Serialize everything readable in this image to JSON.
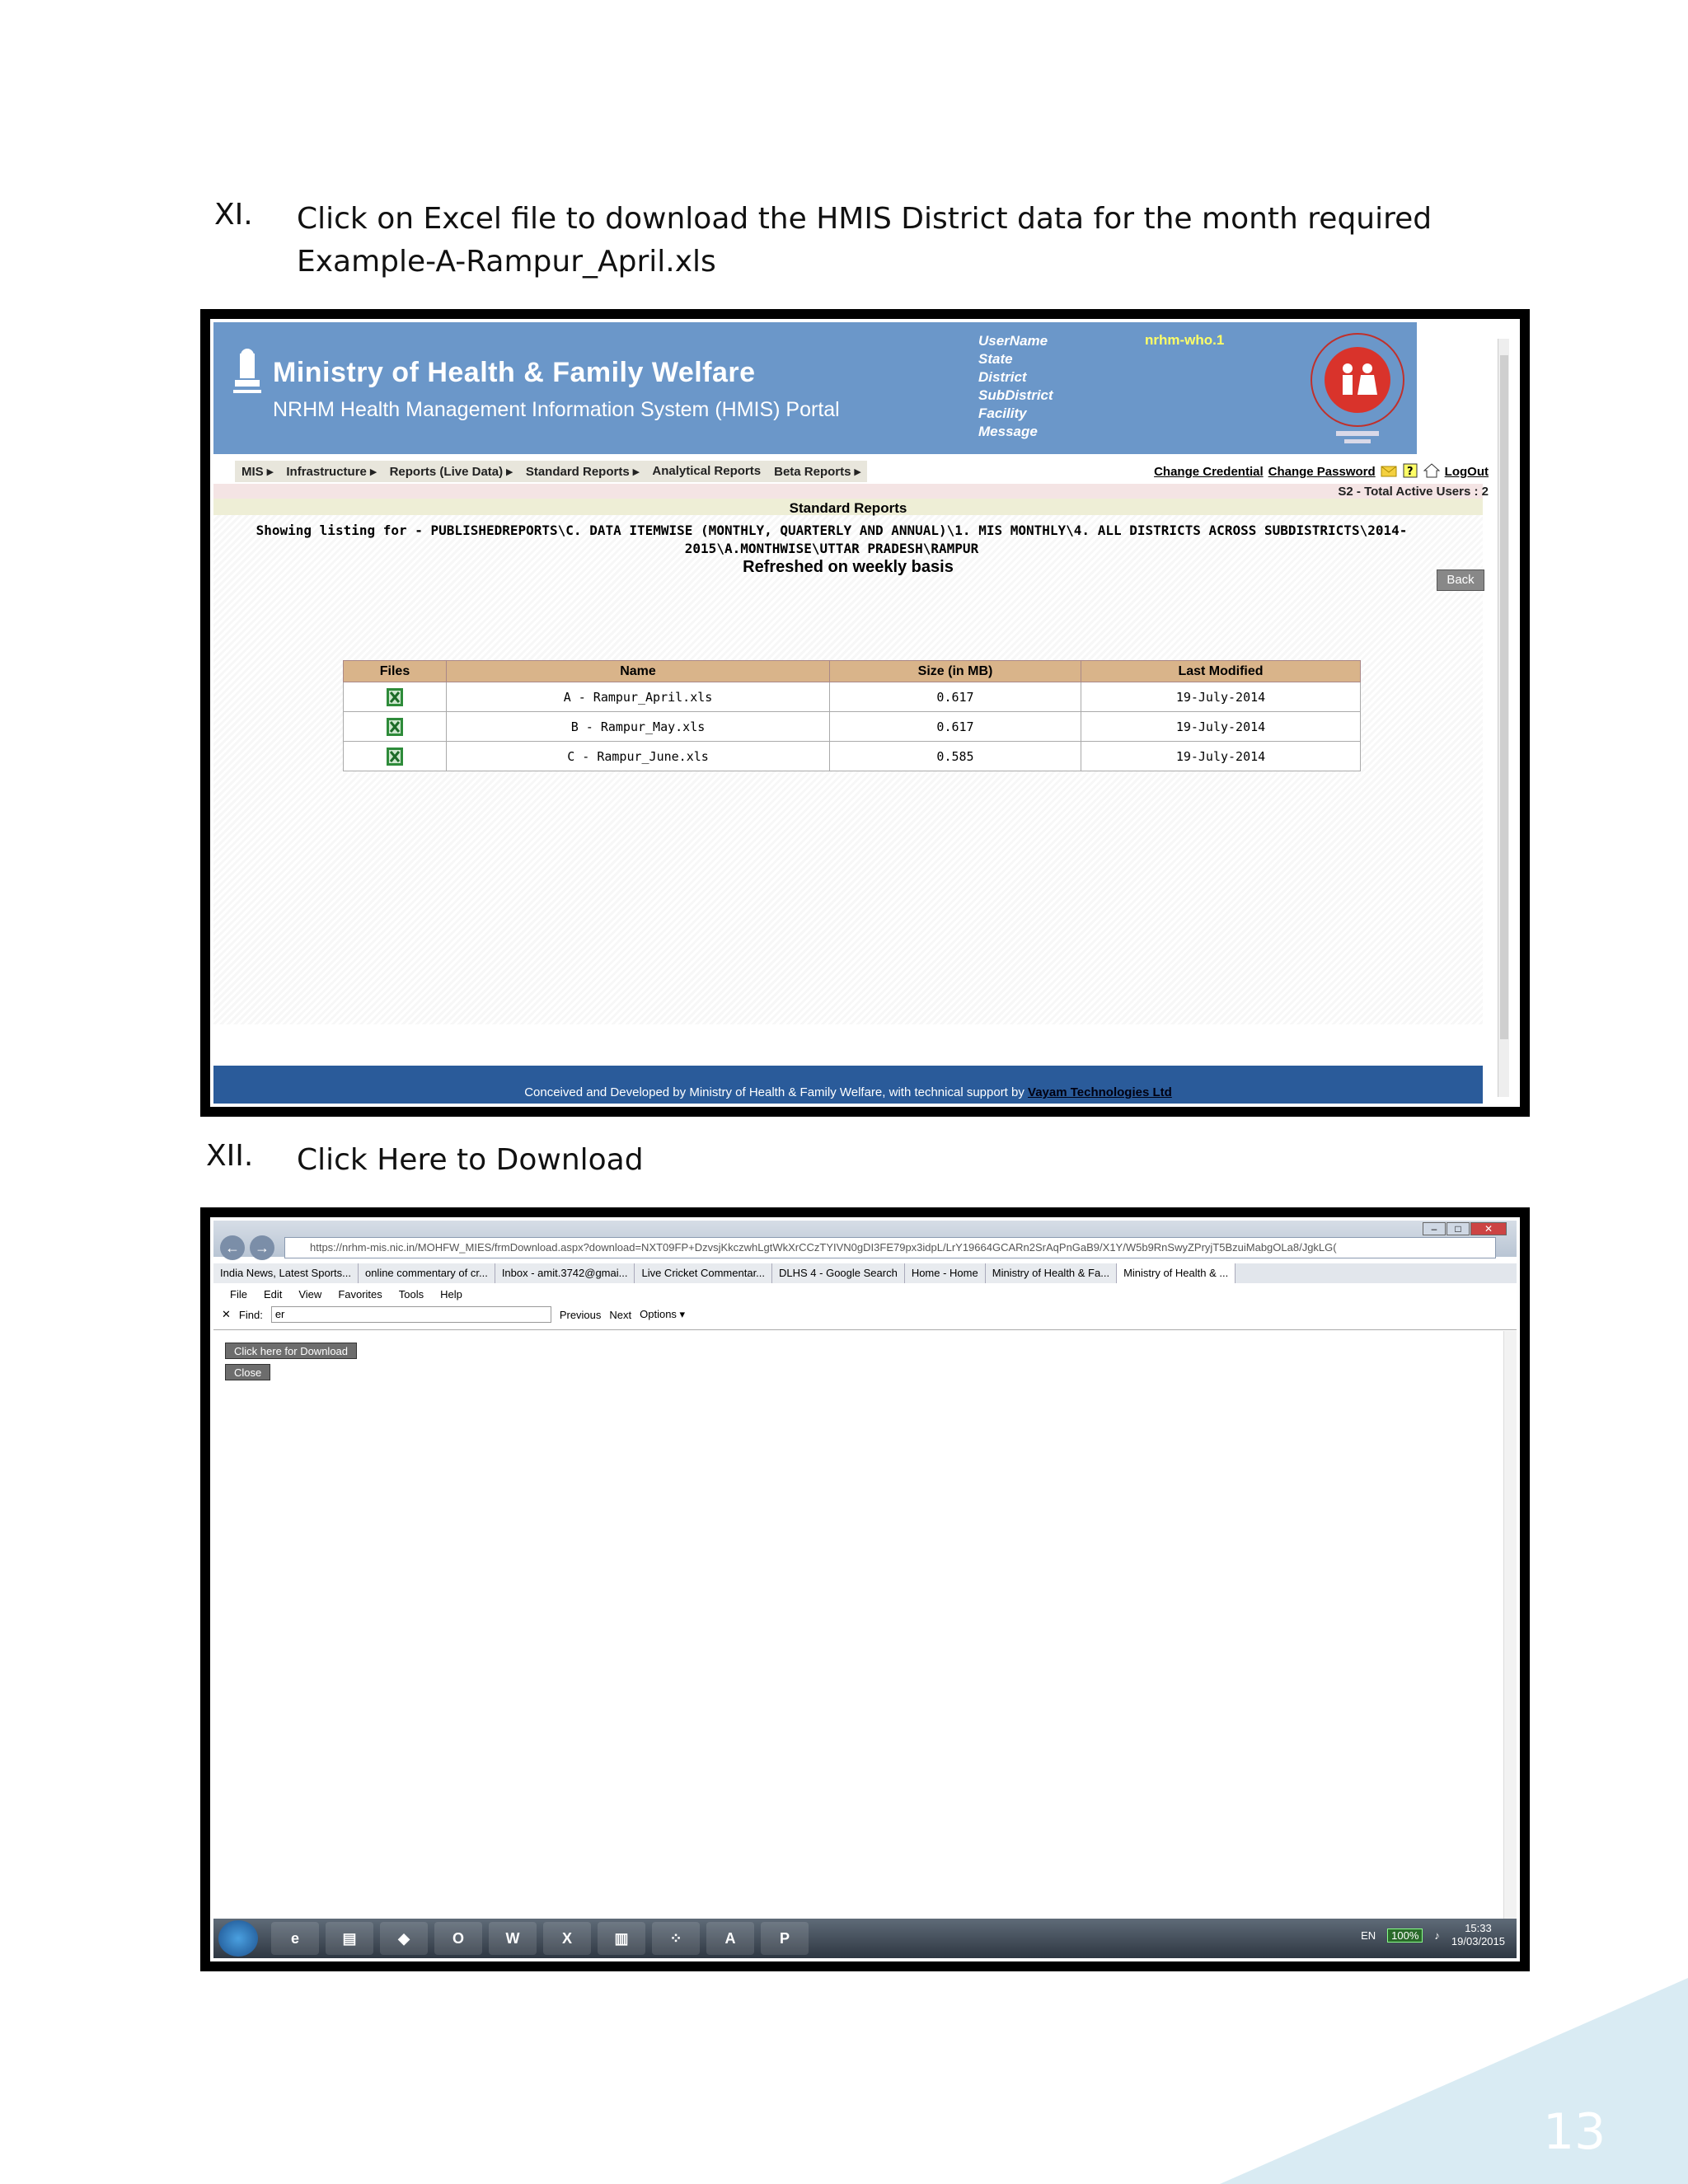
{
  "step11": {
    "number": "XI.",
    "text": "Click on Excel file to download the HMIS District data for the month required  Example-A-Rampur_April.xls"
  },
  "step12": {
    "number": "XII.",
    "text": "Click Here to Download"
  },
  "portal": {
    "title": "Ministry of Health & Family Welfare",
    "subtitle": "NRHM Health Management Information System (HMIS) Portal",
    "user_labels": [
      "UserName",
      "State",
      "District",
      "SubDistrict",
      "Facility",
      "Message"
    ],
    "username_value": "nrhm-who.1",
    "menu": [
      "MIS ▸",
      "Infrastructure ▸",
      "Reports (Live Data) ▸",
      "Standard Reports ▸",
      "Analytical Reports",
      "Beta Reports ▸"
    ],
    "links": {
      "change_credential": "Change Credential",
      "change_password": "Change Password",
      "logout": "LogOut"
    },
    "active_users": "S2 - Total Active Users : 2",
    "section_title": "Standard Reports",
    "listing": "Showing listing for - PUBLISHEDREPORTS\\C. DATA ITEMWISE (MONTHLY, QUARTERLY AND ANNUAL)\\1. MIS MONTHLY\\4. ALL DISTRICTS ACROSS SUBDISTRICTS\\2014-2015\\A.MONTHWISE\\UTTAR PRADESH\\RAMPUR",
    "refreshed": "Refreshed on weekly basis",
    "back_label": "Back",
    "table": {
      "headers": [
        "Files",
        "Name",
        "Size (in MB)",
        "Last Modified"
      ],
      "rows": [
        {
          "name": "A - Rampur_April.xls",
          "size": "0.617",
          "modified": "19-July-2014"
        },
        {
          "name": "B - Rampur_May.xls",
          "size": "0.617",
          "modified": "19-July-2014"
        },
        {
          "name": "C - Rampur_June.xls",
          "size": "0.585",
          "modified": "19-July-2014"
        }
      ]
    },
    "footer_text": "Conceived and Developed by Ministry of Health & Family Welfare, with technical support by ",
    "footer_link": "Vayam Technologies Ltd"
  },
  "browser": {
    "address": "https://nrhm-mis.nic.in/MOHFW_MIES/frmDownload.aspx?download=NXT09FP+DzvsjKkczwhLgtWkXrCCzTYIVN0gDI3FE79px3idpL/LrY19664GCARn2SrAqPnGaB9/X1Y/W5b9RnSwyZPryjT5BzuiMabgOLa8/JgkLG(",
    "tabs": [
      "India News, Latest Sports...",
      "online commentary of cr...",
      "Inbox - amit.3742@gmai...",
      "Live Cricket Commentar...",
      "DLHS 4 - Google Search",
      "Home - Home",
      "Ministry of Health & Fa...",
      "Ministry of Health & ..."
    ],
    "menu": [
      "File",
      "Edit",
      "View",
      "Favorites",
      "Tools",
      "Help"
    ],
    "find_label": "Find:",
    "find_value": "er",
    "previous": "Previous",
    "next": "Next",
    "options": "Options ▾",
    "download_button": "Click here for Download",
    "close_button": "Close",
    "tray_lang": "EN",
    "battery": "100%",
    "time": "15:33",
    "date": "19/03/2015"
  },
  "page_number": "13"
}
